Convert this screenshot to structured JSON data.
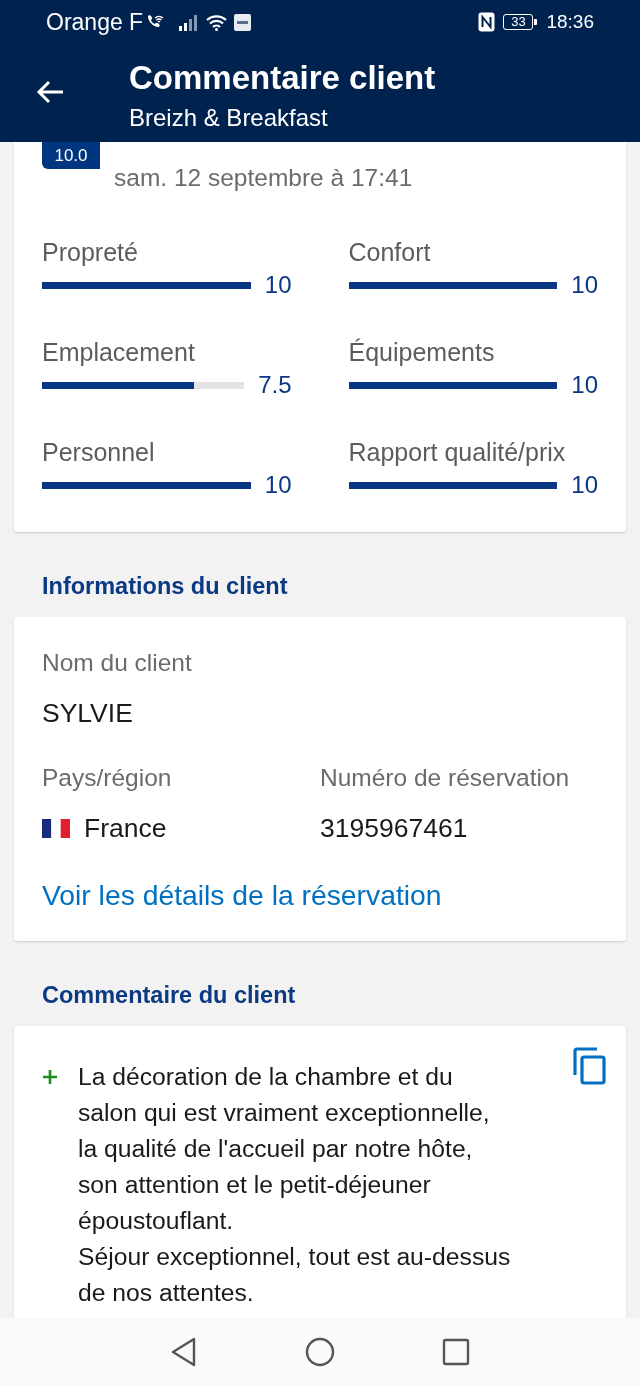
{
  "status_bar": {
    "carrier": "Orange F",
    "battery": "33",
    "time": "18:36"
  },
  "app_bar": {
    "title": "Commentaire client",
    "subtitle": "Breizh & Breakfast"
  },
  "review": {
    "score": "10.0",
    "date": "sam. 12 septembre à 17:41",
    "categories": [
      {
        "label": "Propreté",
        "level": 1,
        "score": "10"
      },
      {
        "label": "Confort",
        "level": 1,
        "score": "10"
      },
      {
        "label": "Emplacement",
        "level": 0.75,
        "score": "7.5"
      },
      {
        "label": "Équipements",
        "level": 1,
        "score": "10"
      },
      {
        "label": "Personnel",
        "level": 1,
        "score": "10"
      },
      {
        "label": "Rapport qualité/prix",
        "level": 1,
        "score": "10"
      }
    ]
  },
  "guest_info": {
    "heading": "Informations du client",
    "name_label": "Nom du client",
    "name": "SYLVIE",
    "country_label": "Pays/région",
    "country": "France",
    "booking_number_label": "Numéro de réservation",
    "booking_number": "3195967461",
    "link": "Voir les détails de la réservation"
  },
  "guest_comment": {
    "heading": "Commentaire du client",
    "items": [
      {
        "kind": "positive",
        "text": "La décoration de la chambre et du salon qui est vraiment exceptionnelle, la qualité de l'accueil par notre hôte, son attention et le petit-déjeuner époustouflant.\nSéjour exceptionnel, tout est au-dessus de nos attentes."
      }
    ]
  }
}
